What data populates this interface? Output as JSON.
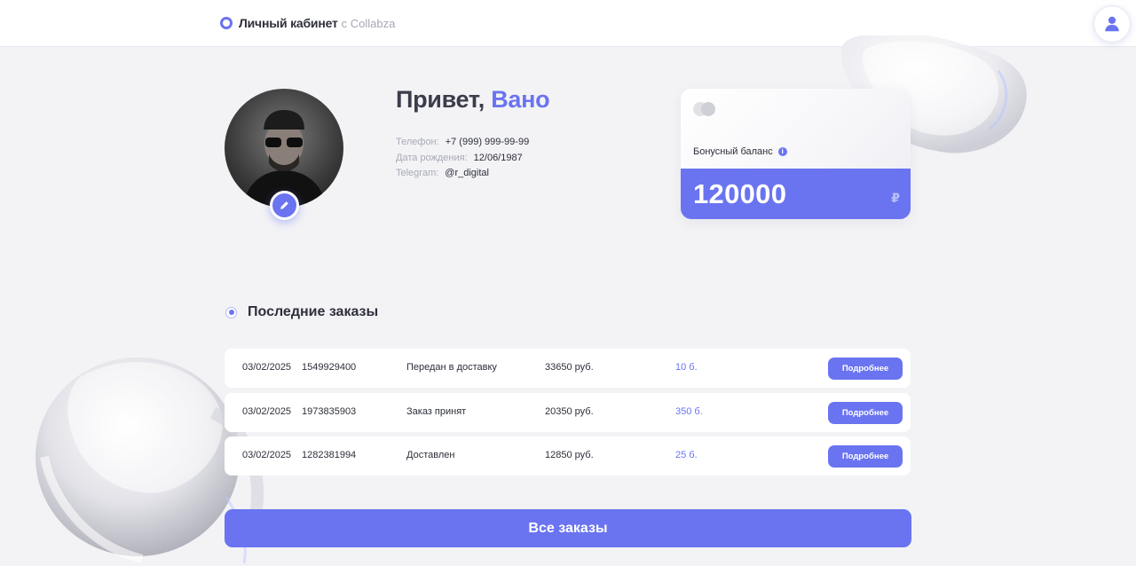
{
  "header": {
    "title": "Личный кабинет",
    "subtitle": "с Collabza",
    "icons": {
      "brand": "ring-logo-icon",
      "user": "user-icon"
    }
  },
  "profile": {
    "greeting": "Привет,",
    "name": "Вано",
    "fields": [
      {
        "label": "Телефон:",
        "value": "+7 (999) 999-99-99"
      },
      {
        "label": "Дата рождения:",
        "value": "12/06/1987"
      },
      {
        "label": "Telegram:",
        "value": "@r_digital"
      }
    ],
    "edit_icon": "pencil-icon"
  },
  "bonus": {
    "label": "Бонусный баланс",
    "value": "120000",
    "currency": "₽",
    "info_icon": "i"
  },
  "orders": {
    "title": "Последние заказы",
    "rows": [
      {
        "date": "03/02/2025",
        "number": "1549929400",
        "status": "Передан в доставку",
        "sum": "33650 руб.",
        "bonus": "10 б.",
        "action": "Подробнее"
      },
      {
        "date": "03/02/2025",
        "number": "1973835903",
        "status": "Заказ принят",
        "sum": "20350 руб.",
        "bonus": "350 б.",
        "action": "Подробнее"
      },
      {
        "date": "03/02/2025",
        "number": "1282381994",
        "status": "Доставлен",
        "sum": "12850 руб.",
        "bonus": "25 б.",
        "action": "Подробнее"
      }
    ],
    "all_label": "Все заказы"
  },
  "colors": {
    "accent": "#6a74f0",
    "background": "#f3f3f6",
    "text": "#2d2f3a",
    "muted": "#a8aab6"
  }
}
